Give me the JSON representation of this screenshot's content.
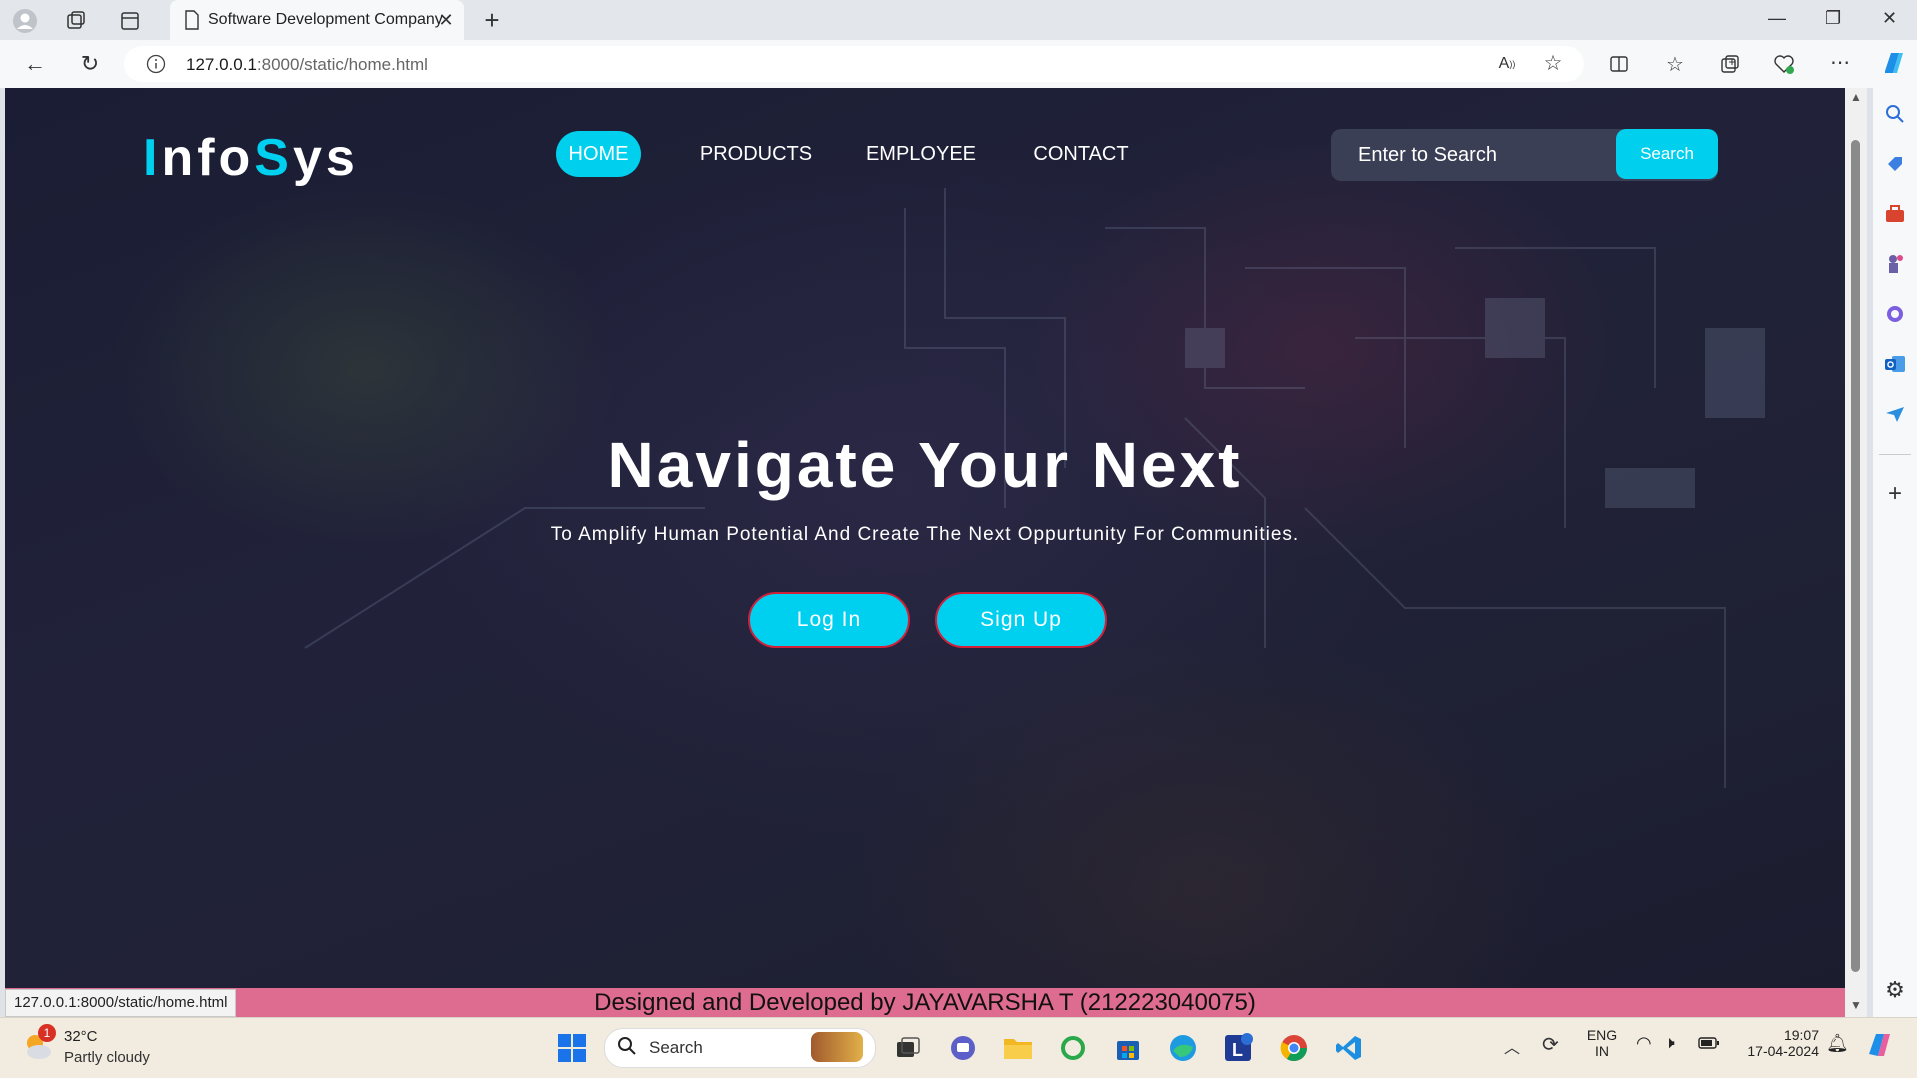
{
  "browser": {
    "tab_title": "Software Development Company",
    "url_host": "127.0.0.1",
    "url_rest": ":8000/static/home.html",
    "status_url": "127.0.0.1:8000/static/home.html"
  },
  "site": {
    "logo_part1": "Info",
    "logo_part2": "Sys",
    "nav": [
      {
        "label": "HOME",
        "active": true
      },
      {
        "label": "PRODUCTS"
      },
      {
        "label": "EMPLOYEE"
      },
      {
        "label": "CONTACT"
      }
    ],
    "search_placeholder": "Enter to Search",
    "search_button": "Search",
    "hero_title": "Navigate Your Next",
    "hero_subtitle": "To Amplify Human Potential And Create The Next Oppurtunity For Communities.",
    "login_button": "Log In",
    "signup_button": "Sign Up",
    "footer": "Designed and Developed by JAYAVARSHA T (212223040075)"
  },
  "taskbar": {
    "weather_temp": "32°C",
    "weather_desc": "Partly cloudy",
    "weather_badge": "1",
    "search_label": "Search",
    "lang_top": "ENG",
    "lang_bottom": "IN",
    "time": "19:07",
    "date": "17-04-2024"
  },
  "colors": {
    "accent": "#00cfee",
    "footer": "#de6c91",
    "button_border": "#d0203a"
  }
}
